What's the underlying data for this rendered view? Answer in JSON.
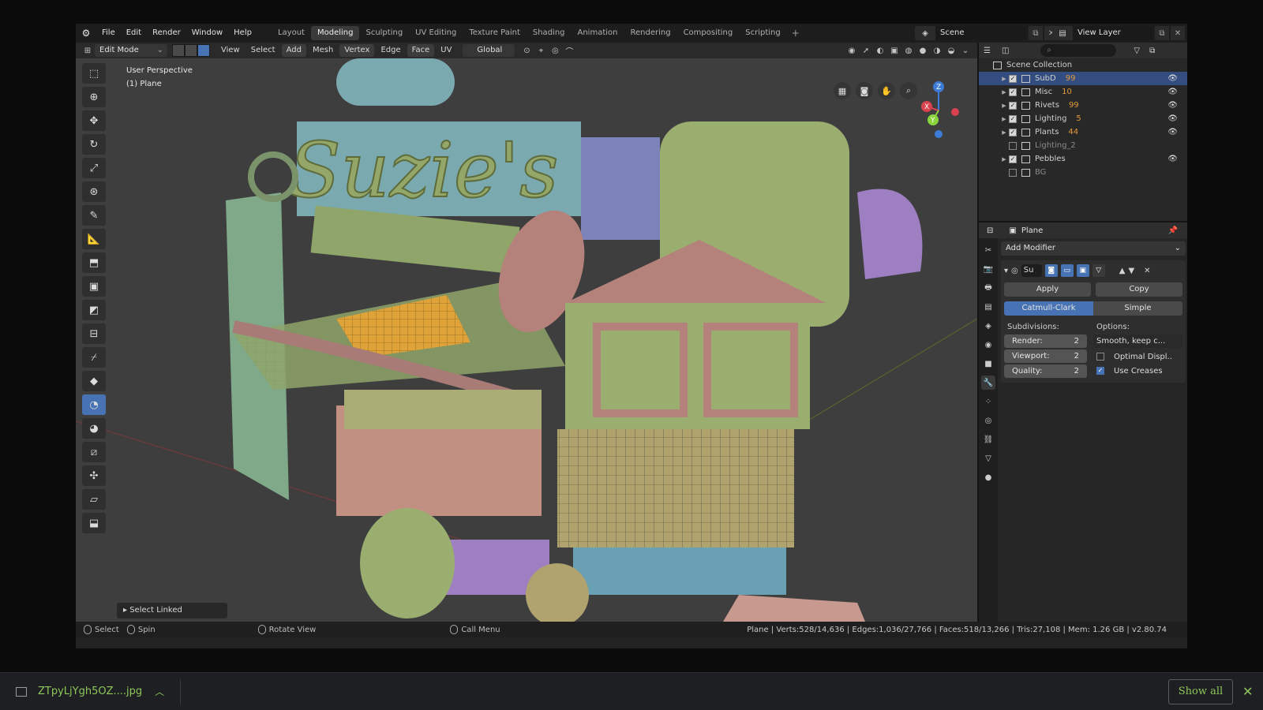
{
  "menu": [
    "File",
    "Edit",
    "Render",
    "Window",
    "Help"
  ],
  "workspaces": [
    {
      "label": "Layout",
      "active": false
    },
    {
      "label": "Modeling",
      "active": true
    },
    {
      "label": "Sculpting",
      "active": false
    },
    {
      "label": "UV Editing",
      "active": false
    },
    {
      "label": "Texture Paint",
      "active": false
    },
    {
      "label": "Shading",
      "active": false
    },
    {
      "label": "Animation",
      "active": false
    },
    {
      "label": "Rendering",
      "active": false
    },
    {
      "label": "Compositing",
      "active": false
    },
    {
      "label": "Scripting",
      "active": false
    }
  ],
  "scene": {
    "name": "Scene",
    "view_layer": "View Layer"
  },
  "viewport_header": {
    "mode": "Edit Mode",
    "menus": [
      "View",
      "Select",
      "Add",
      "Mesh",
      "Vertex",
      "Edge",
      "Face",
      "UV"
    ],
    "orientation": "Global"
  },
  "viewport": {
    "perspective": "User Perspective",
    "object": "(1) Plane",
    "last_op": "Select Linked",
    "axes": {
      "x": "X",
      "y": "Y",
      "z": "Z"
    }
  },
  "outliner": {
    "root": "Scene Collection",
    "items": [
      {
        "label": "SubD",
        "checked": true,
        "selected": true,
        "expand": true,
        "badge": "99",
        "eye": true
      },
      {
        "label": "Misc",
        "checked": true,
        "selected": false,
        "expand": true,
        "badge": "10",
        "eye": true
      },
      {
        "label": "Rivets",
        "checked": true,
        "selected": false,
        "expand": true,
        "badge": "99",
        "eye": true
      },
      {
        "label": "Lighting",
        "checked": true,
        "selected": false,
        "expand": true,
        "badge": "5",
        "eye": true
      },
      {
        "label": "Plants",
        "checked": true,
        "selected": false,
        "expand": true,
        "badge": "44",
        "eye": true
      },
      {
        "label": "Lighting_2",
        "checked": false,
        "selected": false,
        "expand": false,
        "badge": "",
        "eye": false
      },
      {
        "label": "Pebbles",
        "checked": true,
        "selected": false,
        "expand": true,
        "badge": "",
        "eye": true
      },
      {
        "label": "BG",
        "checked": false,
        "selected": false,
        "expand": false,
        "badge": "",
        "eye": false
      }
    ]
  },
  "properties": {
    "object_name": "Plane",
    "add_modifier": "Add Modifier",
    "modifier_name": "Su",
    "apply": "Apply",
    "copy": "Copy",
    "catmull": "Catmull-Clark",
    "simple": "Simple",
    "subdivisions_label": "Subdivisions:",
    "options_label": "Options:",
    "render_label": "Render:",
    "render_value": "2",
    "viewport_label": "Viewport:",
    "viewport_value": "2",
    "quality_label": "Quality:",
    "quality_value": "2",
    "smooth_option": "Smooth, keep c...",
    "optimal_display": "Optimal Displ..",
    "use_creases": "Use Creases"
  },
  "status": {
    "select": "Select",
    "spin": "Spin",
    "rotate_view": "Rotate View",
    "call_menu": "Call Menu",
    "stats": "Plane | Verts:528/14,636 | Edges:1,036/27,766 | Faces:518/13,266 | Tris:27,108 | Mem: 1.26 GB | v2.80.74"
  },
  "download": {
    "filename": "ZTpyLjYgh5OZ....jpg",
    "show_all": "Show all"
  },
  "colors": {
    "accent": "#4772b3",
    "download_green": "#8ec75a",
    "selected_row": "#334d80"
  }
}
